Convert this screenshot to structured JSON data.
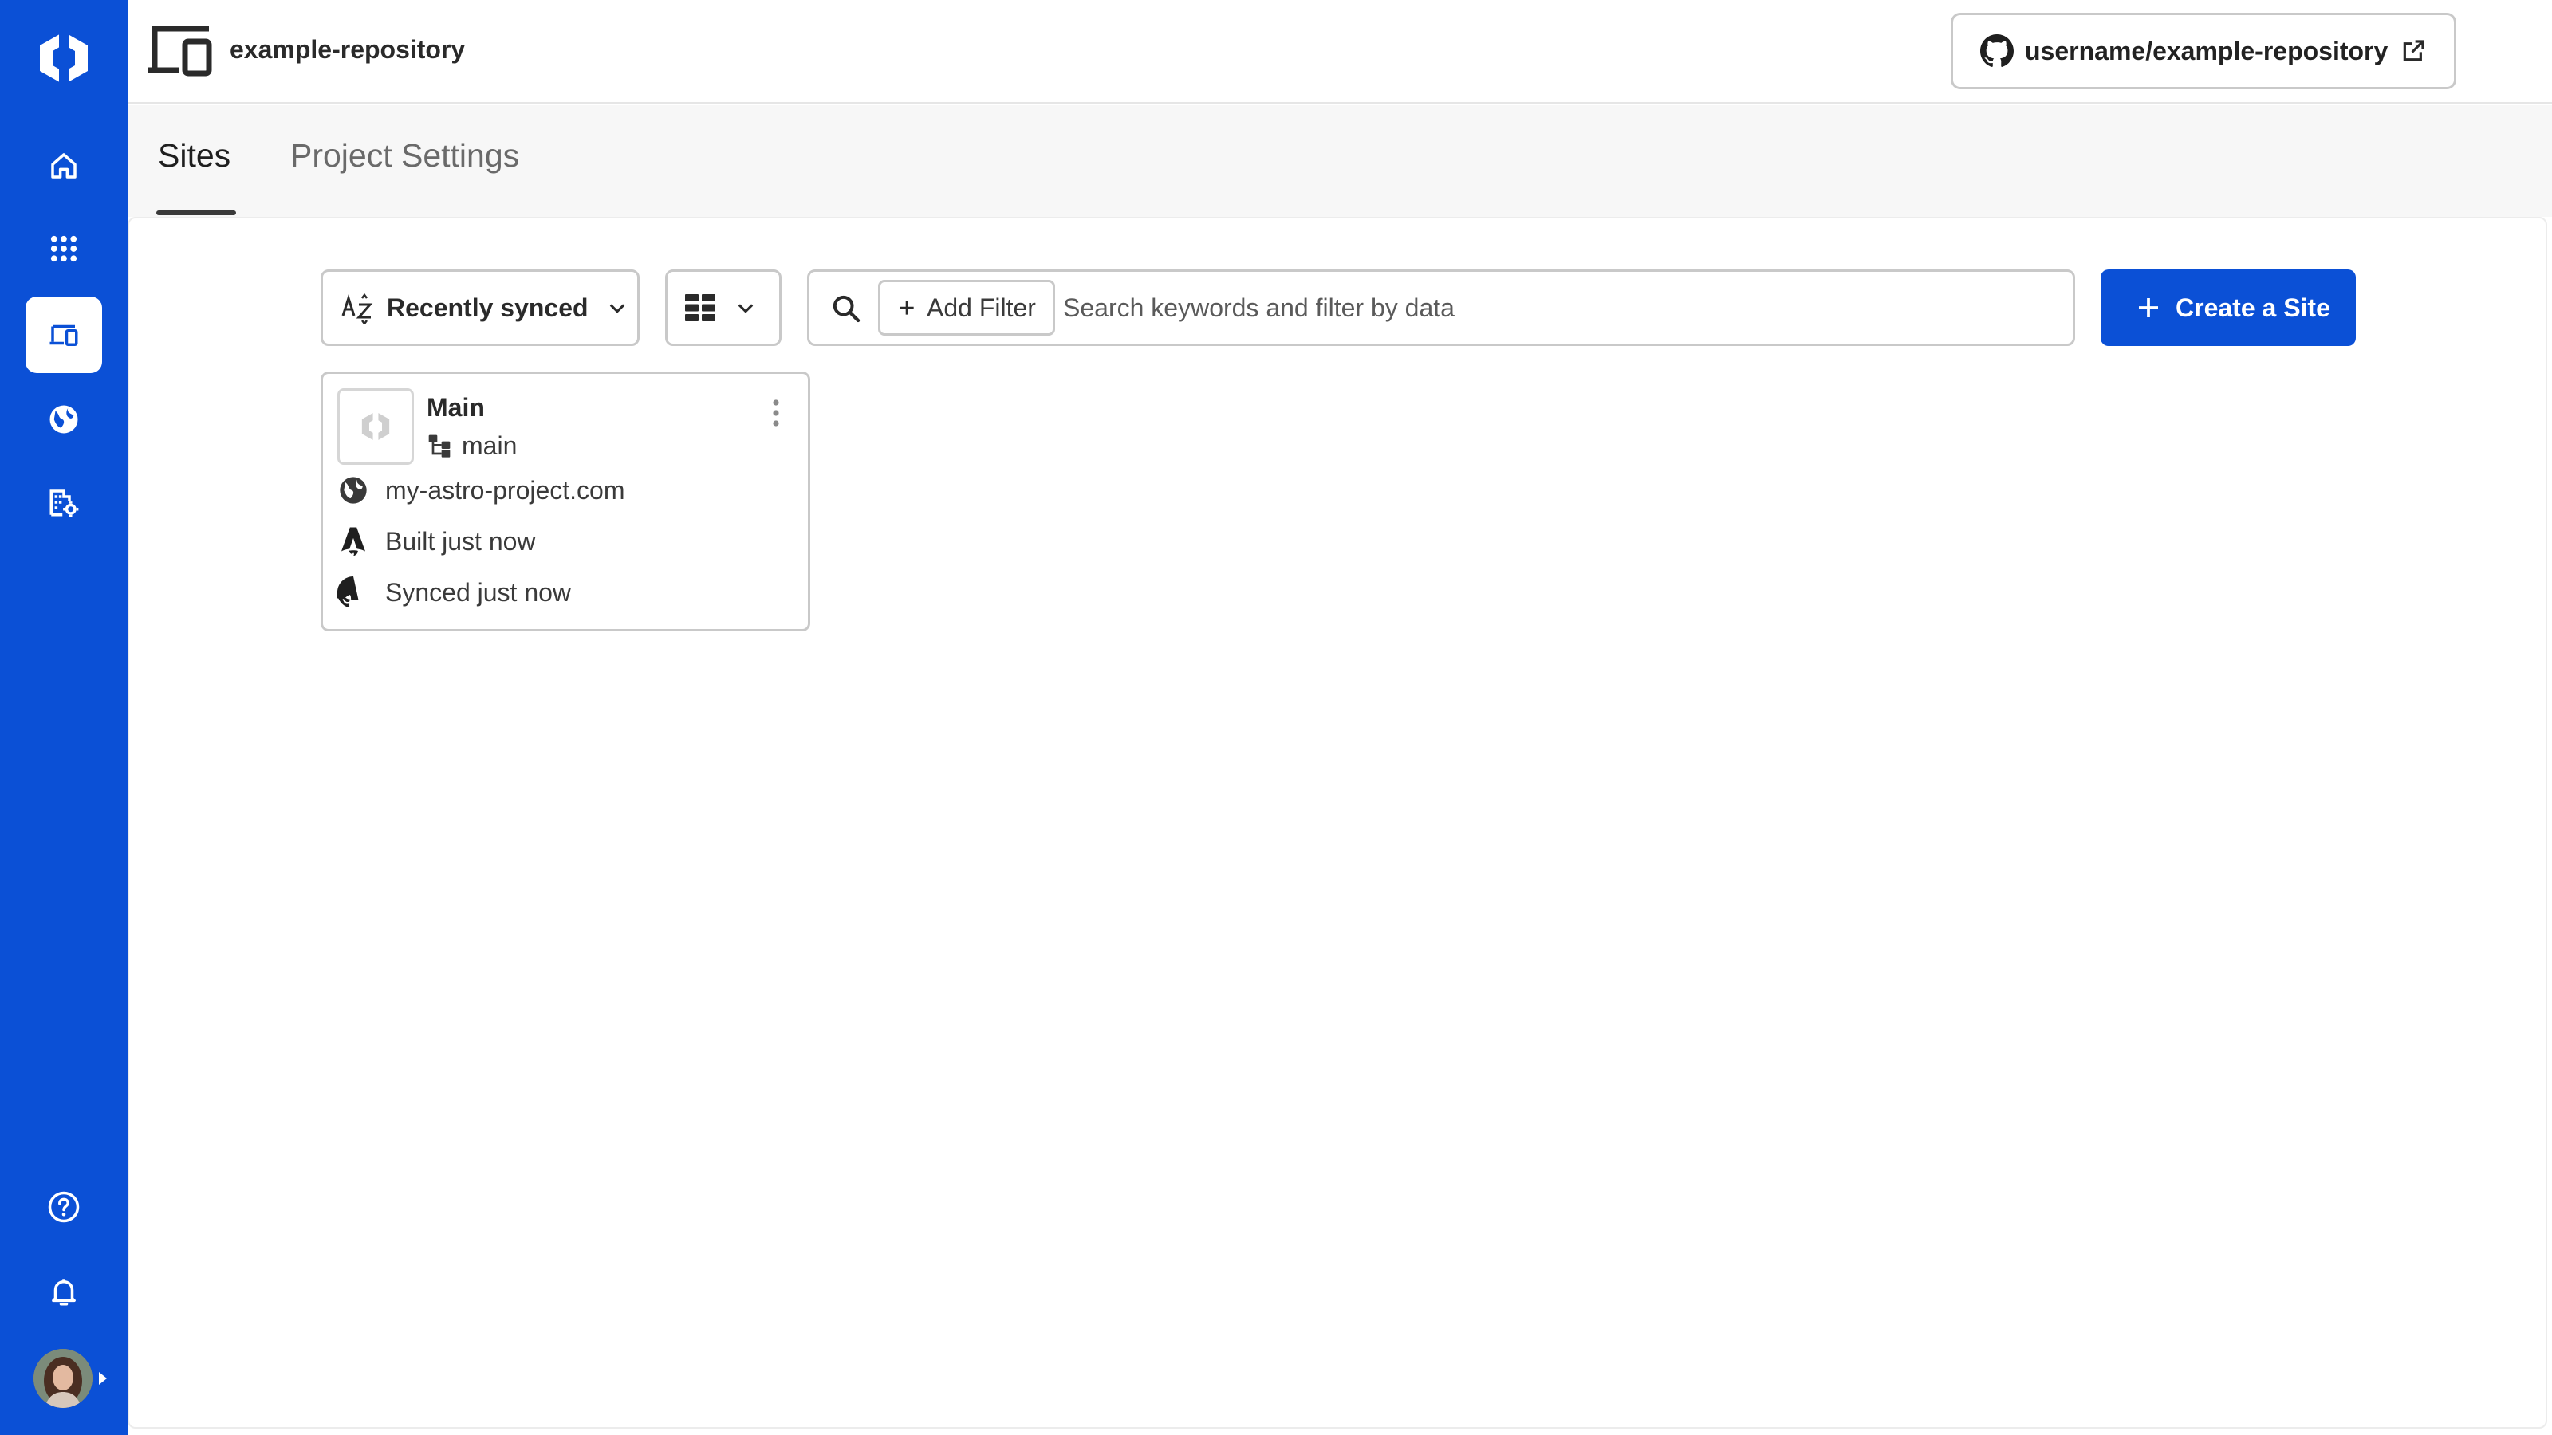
{
  "header": {
    "project_name": "example-repository",
    "repo_link_label": "username/example-repository"
  },
  "tabs": [
    {
      "label": "Sites",
      "active": true
    },
    {
      "label": "Project Settings",
      "active": false
    }
  ],
  "toolbar": {
    "sort_label": "Recently synced",
    "add_filter_label": "Add Filter",
    "search_placeholder": "Search keywords and filter by data",
    "search_value": "",
    "create_label": "Create a Site"
  },
  "site_card": {
    "title": "Main",
    "branch": "main",
    "domain": "my-astro-project.com",
    "built_status": "Built just now",
    "synced_status": "Synced just now"
  },
  "sidebar": {
    "items": [
      {
        "name": "home",
        "icon": "home-icon",
        "active": false
      },
      {
        "name": "apps",
        "icon": "apps-grid-icon",
        "active": false
      },
      {
        "name": "projects",
        "icon": "devices-icon",
        "active": true
      },
      {
        "name": "domains",
        "icon": "globe-icon",
        "active": false
      },
      {
        "name": "organization",
        "icon": "organization-settings-icon",
        "active": false
      }
    ],
    "bottom_items": [
      {
        "name": "help",
        "icon": "help-icon"
      },
      {
        "name": "notifications",
        "icon": "bell-icon"
      }
    ]
  },
  "colors": {
    "brand": "#0b50d6",
    "border": "#c9c9c9",
    "text": "#1f1f1f",
    "muted": "#6a6a6a"
  }
}
